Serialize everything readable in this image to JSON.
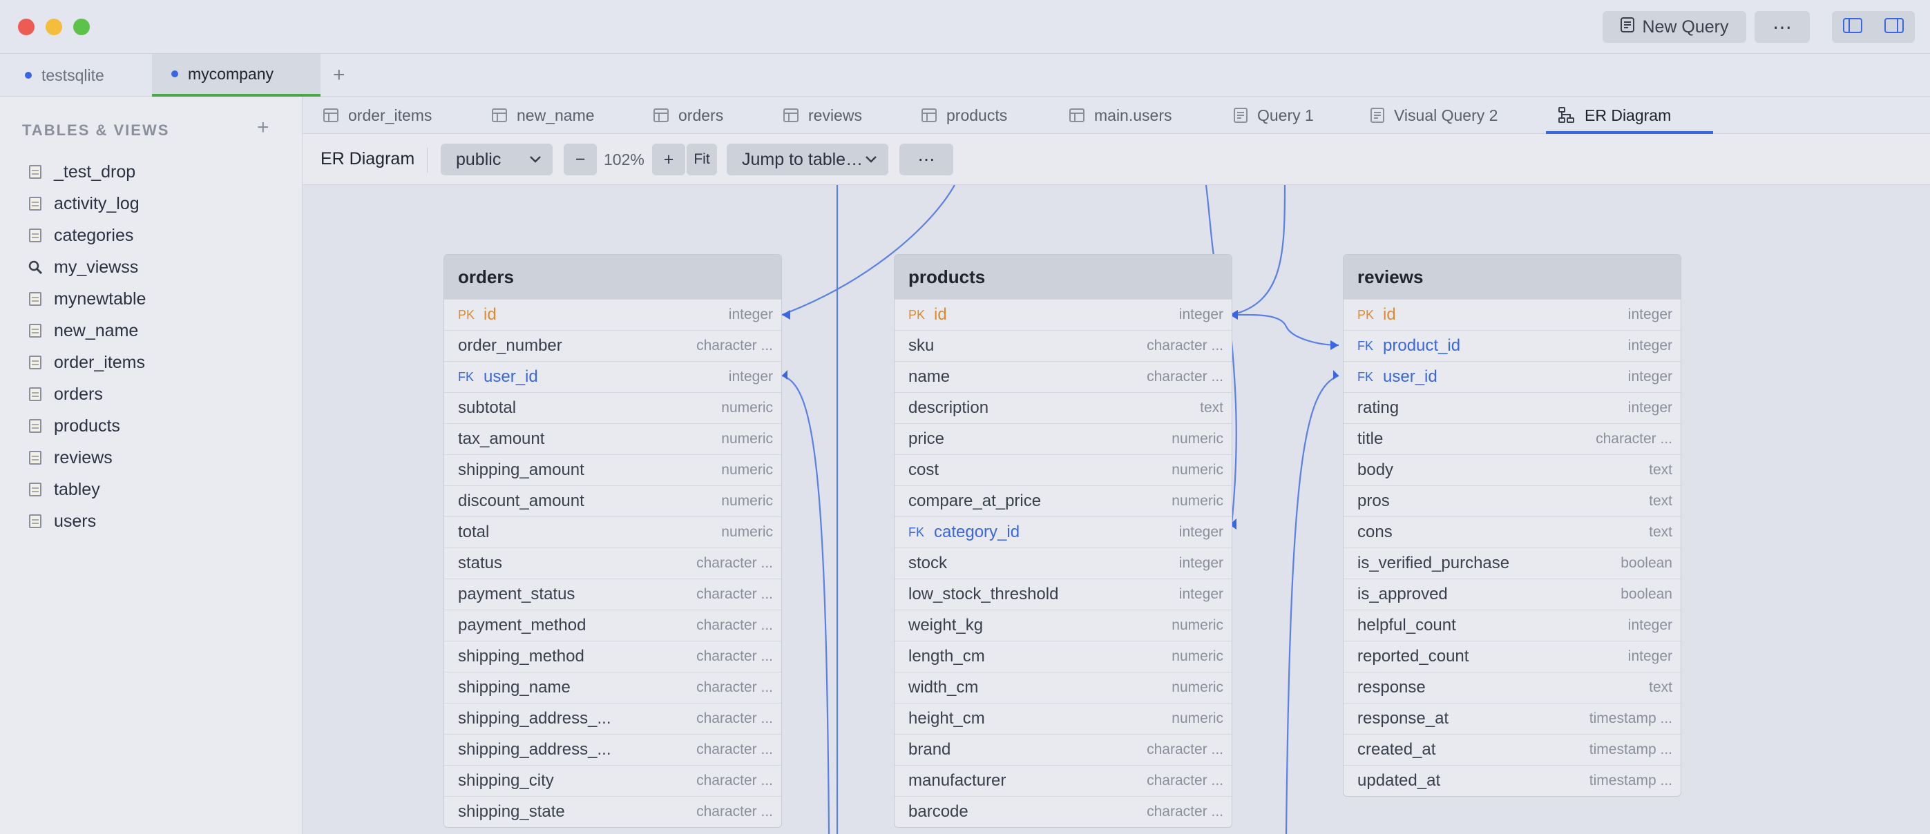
{
  "titlebar": {
    "new_query_label": "New Query",
    "more_label": "⋯",
    "icons": [
      "sidebar-left-icon",
      "sidebar-right-icon"
    ]
  },
  "connections": [
    {
      "label": "testsqlite",
      "active": false
    },
    {
      "label": "mycompany",
      "active": true
    }
  ],
  "connection_add": "+",
  "sidebar": {
    "heading": "TABLES & VIEWS",
    "add": "+",
    "items": [
      {
        "label": "_test_drop",
        "icon": "table-icon"
      },
      {
        "label": "activity_log",
        "icon": "table-icon"
      },
      {
        "label": "categories",
        "icon": "table-icon"
      },
      {
        "label": "my_viewss",
        "icon": "view-icon"
      },
      {
        "label": "mynewtable",
        "icon": "table-icon"
      },
      {
        "label": "new_name",
        "icon": "table-icon"
      },
      {
        "label": "order_items",
        "icon": "table-icon"
      },
      {
        "label": "orders",
        "icon": "table-icon"
      },
      {
        "label": "products",
        "icon": "table-icon"
      },
      {
        "label": "reviews",
        "icon": "table-icon"
      },
      {
        "label": "tabley",
        "icon": "table-icon"
      },
      {
        "label": "users",
        "icon": "table-icon"
      }
    ]
  },
  "tabs": [
    {
      "label": "order_items",
      "icon": "table-icon"
    },
    {
      "label": "new_name",
      "icon": "table-icon"
    },
    {
      "label": "orders",
      "icon": "table-icon"
    },
    {
      "label": "reviews",
      "icon": "table-icon"
    },
    {
      "label": "products",
      "icon": "table-icon"
    },
    {
      "label": "main.users",
      "icon": "table-icon"
    },
    {
      "label": "Query 1",
      "icon": "query-icon"
    },
    {
      "label": "Visual Query 2",
      "icon": "query-icon"
    },
    {
      "label": "ER Diagram",
      "icon": "er-diagram-icon",
      "active": true
    }
  ],
  "toolbar": {
    "title": "ER Diagram",
    "schema": "public",
    "minus": "−",
    "zoom": "102%",
    "plus": "+",
    "fit": "Fit",
    "jump": "Jump to table…",
    "more": "⋯"
  },
  "accent": "#3a66e0",
  "pk_color": "#e08a2c",
  "entities": [
    {
      "name": "orders",
      "columns": [
        {
          "key": "PK",
          "name": "id",
          "type": "integer"
        },
        {
          "key": "",
          "name": "order_number",
          "type": "character ..."
        },
        {
          "key": "FK",
          "name": "user_id",
          "type": "integer"
        },
        {
          "key": "",
          "name": "subtotal",
          "type": "numeric"
        },
        {
          "key": "",
          "name": "tax_amount",
          "type": "numeric"
        },
        {
          "key": "",
          "name": "shipping_amount",
          "type": "numeric"
        },
        {
          "key": "",
          "name": "discount_amount",
          "type": "numeric"
        },
        {
          "key": "",
          "name": "total",
          "type": "numeric"
        },
        {
          "key": "",
          "name": "status",
          "type": "character ..."
        },
        {
          "key": "",
          "name": "payment_status",
          "type": "character ..."
        },
        {
          "key": "",
          "name": "payment_method",
          "type": "character ..."
        },
        {
          "key": "",
          "name": "shipping_method",
          "type": "character ..."
        },
        {
          "key": "",
          "name": "shipping_name",
          "type": "character ..."
        },
        {
          "key": "",
          "name": "shipping_address_...",
          "type": "character ..."
        },
        {
          "key": "",
          "name": "shipping_address_...",
          "type": "character ..."
        },
        {
          "key": "",
          "name": "shipping_city",
          "type": "character ..."
        },
        {
          "key": "",
          "name": "shipping_state",
          "type": "character ..."
        }
      ]
    },
    {
      "name": "products",
      "columns": [
        {
          "key": "PK",
          "name": "id",
          "type": "integer"
        },
        {
          "key": "",
          "name": "sku",
          "type": "character ..."
        },
        {
          "key": "",
          "name": "name",
          "type": "character ..."
        },
        {
          "key": "",
          "name": "description",
          "type": "text"
        },
        {
          "key": "",
          "name": "price",
          "type": "numeric"
        },
        {
          "key": "",
          "name": "cost",
          "type": "numeric"
        },
        {
          "key": "",
          "name": "compare_at_price",
          "type": "numeric"
        },
        {
          "key": "FK",
          "name": "category_id",
          "type": "integer"
        },
        {
          "key": "",
          "name": "stock",
          "type": "integer"
        },
        {
          "key": "",
          "name": "low_stock_threshold",
          "type": "integer"
        },
        {
          "key": "",
          "name": "weight_kg",
          "type": "numeric"
        },
        {
          "key": "",
          "name": "length_cm",
          "type": "numeric"
        },
        {
          "key": "",
          "name": "width_cm",
          "type": "numeric"
        },
        {
          "key": "",
          "name": "height_cm",
          "type": "numeric"
        },
        {
          "key": "",
          "name": "brand",
          "type": "character ..."
        },
        {
          "key": "",
          "name": "manufacturer",
          "type": "character ..."
        },
        {
          "key": "",
          "name": "barcode",
          "type": "character ..."
        }
      ]
    },
    {
      "name": "reviews",
      "columns": [
        {
          "key": "PK",
          "name": "id",
          "type": "integer"
        },
        {
          "key": "FK",
          "name": "product_id",
          "type": "integer"
        },
        {
          "key": "FK",
          "name": "user_id",
          "type": "integer"
        },
        {
          "key": "",
          "name": "rating",
          "type": "integer"
        },
        {
          "key": "",
          "name": "title",
          "type": "character ..."
        },
        {
          "key": "",
          "name": "body",
          "type": "text"
        },
        {
          "key": "",
          "name": "pros",
          "type": "text"
        },
        {
          "key": "",
          "name": "cons",
          "type": "text"
        },
        {
          "key": "",
          "name": "is_verified_purchase",
          "type": "boolean"
        },
        {
          "key": "",
          "name": "is_approved",
          "type": "boolean"
        },
        {
          "key": "",
          "name": "helpful_count",
          "type": "integer"
        },
        {
          "key": "",
          "name": "reported_count",
          "type": "integer"
        },
        {
          "key": "",
          "name": "response",
          "type": "text"
        },
        {
          "key": "",
          "name": "response_at",
          "type": "timestamp ..."
        },
        {
          "key": "",
          "name": "created_at",
          "type": "timestamp ..."
        },
        {
          "key": "",
          "name": "updated_at",
          "type": "timestamp ..."
        }
      ]
    }
  ]
}
